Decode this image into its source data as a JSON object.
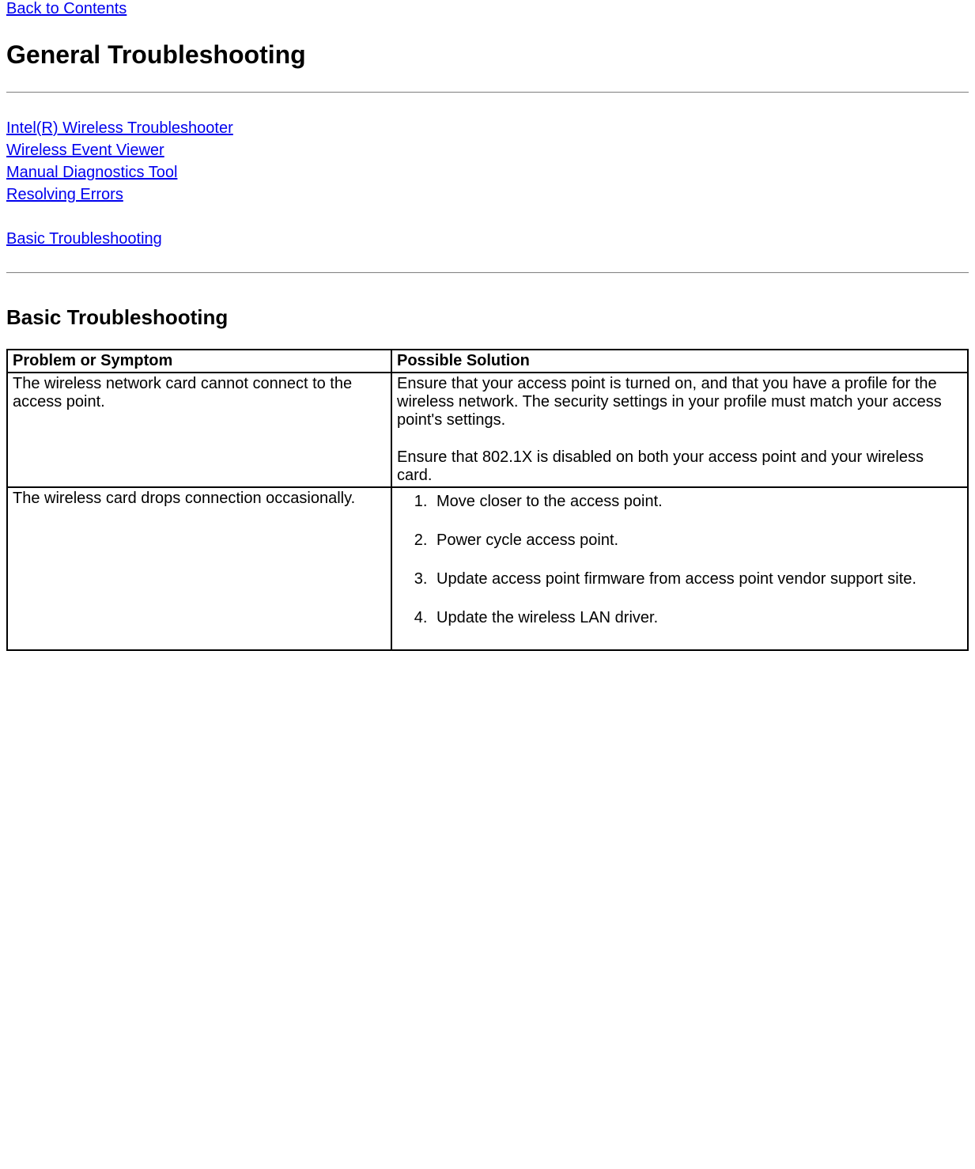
{
  "nav": {
    "back_to_contents": "Back to Contents"
  },
  "headings": {
    "h1": "General Troubleshooting",
    "h2": "Basic Troubleshooting"
  },
  "links": {
    "l1": "Intel(R) Wireless Troubleshooter",
    "l2": "Wireless Event Viewer",
    "l3": "Manual Diagnostics Tool",
    "l4": "Resolving Errors",
    "l5": "Basic Troubleshooting"
  },
  "table": {
    "header": {
      "problem": "Problem or Symptom",
      "solution": "Possible Solution"
    },
    "rows": [
      {
        "problem": "The wireless network card cannot connect to the access point.",
        "solution_p1": "Ensure that your access point is turned on, and that you have a profile for the wireless network. The security settings in your profile must match your access point's settings.",
        "solution_p2": "Ensure that 802.1X is disabled on both your access point and your wireless card."
      },
      {
        "problem": "The wireless card drops connection occasionally.",
        "solution_list": {
          "i1": "Move closer to the access point.",
          "i2": "Power cycle access point.",
          "i3": "Update access point firmware from access point vendor support site.",
          "i4": "Update the wireless LAN driver."
        }
      }
    ]
  }
}
